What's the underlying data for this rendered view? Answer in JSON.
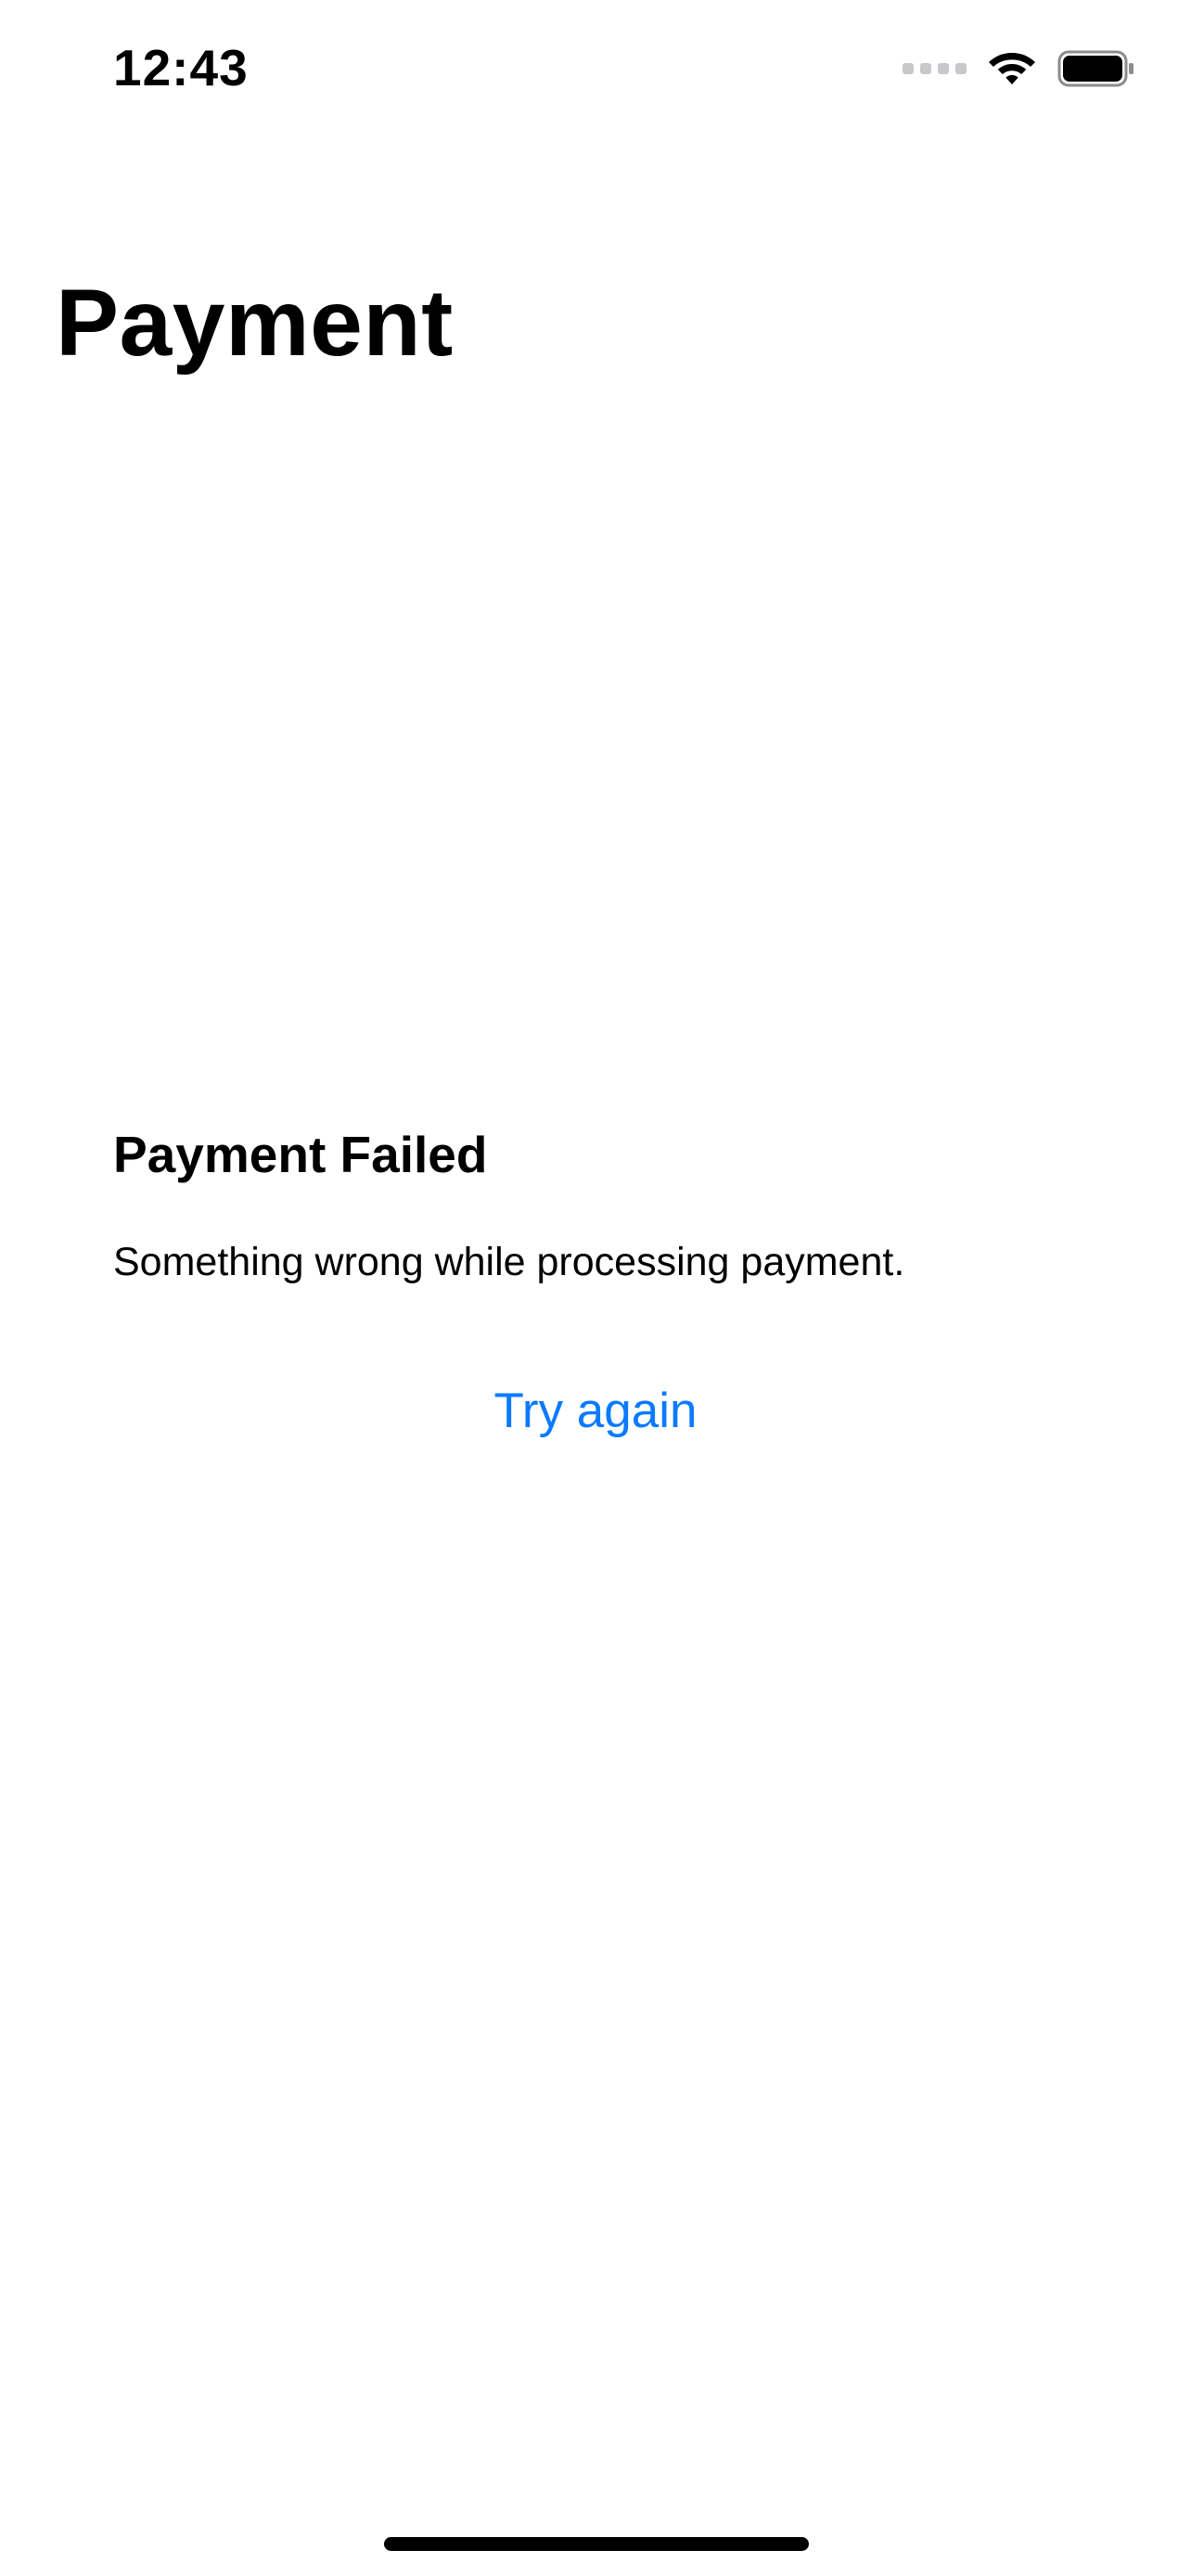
{
  "status_bar": {
    "time": "12:43",
    "icons": [
      "cellular-signal-icon",
      "wifi-icon",
      "battery-icon"
    ]
  },
  "header": {
    "title": "Payment"
  },
  "error": {
    "title": "Payment Failed",
    "message": "Something wrong while processing payment.",
    "retry_label": "Try again"
  },
  "colors": {
    "accent": "#0a7aff",
    "text": "#000000",
    "background": "#ffffff",
    "inactive_signal": "#c7c7cc"
  }
}
